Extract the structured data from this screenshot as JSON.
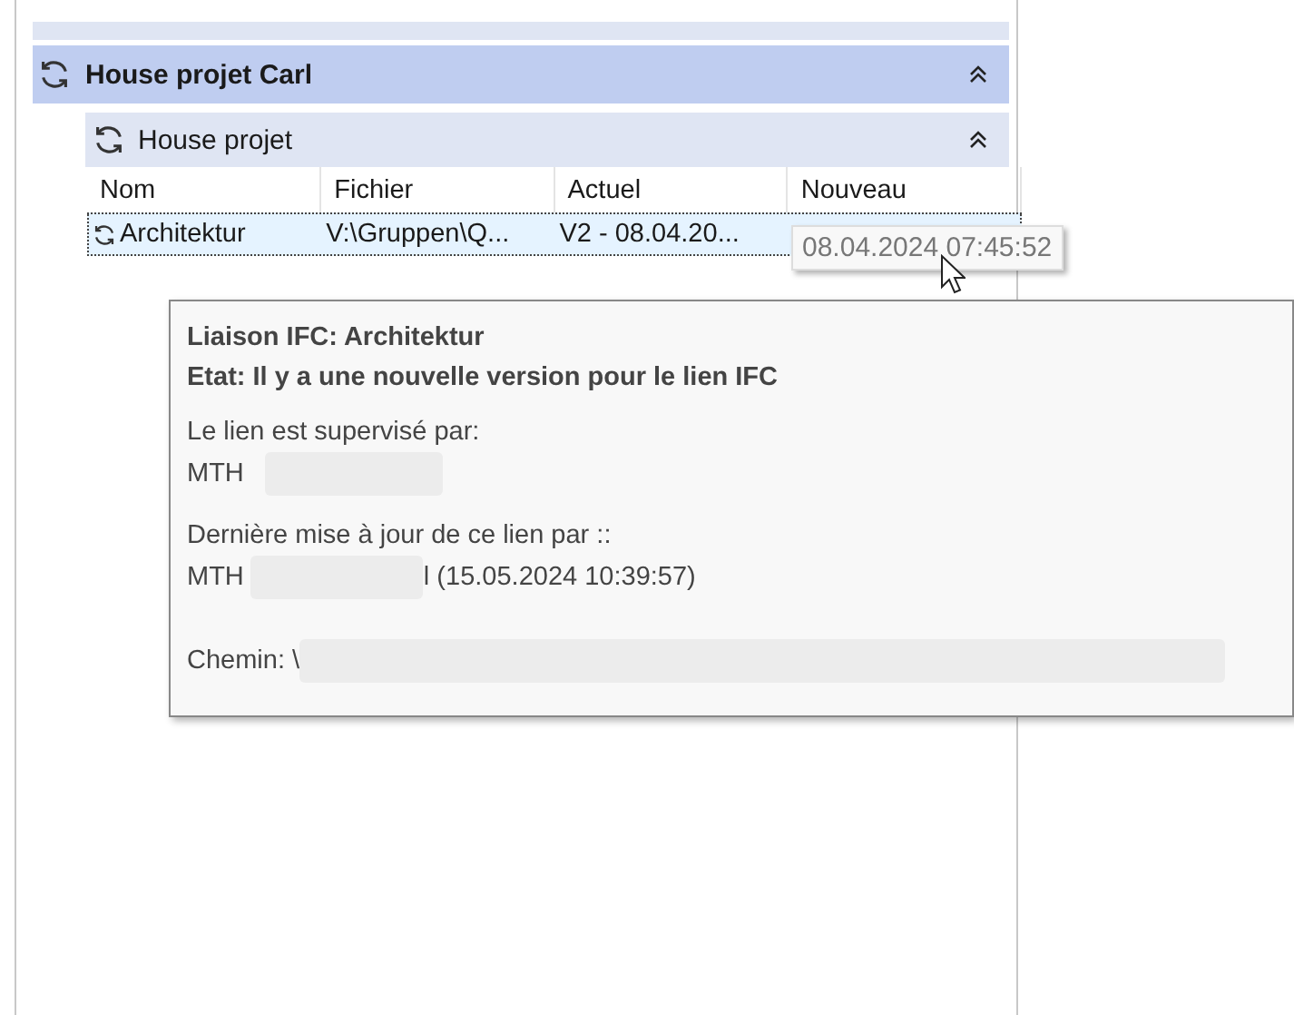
{
  "groups": [
    {
      "title": "House projet Carl",
      "expanded": true,
      "subgroups": [
        {
          "title": "House projet",
          "expanded": true,
          "columns": [
            "Nom",
            "Fichier",
            "Actuel",
            "Nouveau"
          ],
          "rows": [
            {
              "selected": true,
              "cells": [
                "Architektur",
                "V:\\Gruppen\\Q...",
                "V2 - 08.04.20..."
              ]
            }
          ]
        }
      ]
    }
  ],
  "cell_tooltip": "08.04.2024 07:45:52",
  "tooltip": {
    "title": "Liaison IFC: Architektur",
    "status": "Etat: Il y a une nouvelle version pour le lien IFC",
    "sections": [
      {
        "label": "Le lien est supervisé par:",
        "value": "MTH"
      },
      {
        "label": "Dernière mise à jour de ce lien par ::",
        "value": "MTH",
        "suffix": "l (15.05.2024 10:39:57)"
      }
    ],
    "path_label": "Chemin: \\"
  }
}
